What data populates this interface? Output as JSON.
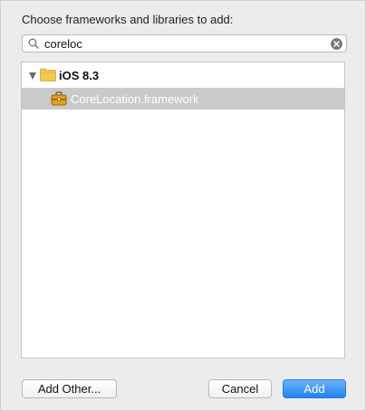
{
  "dialog": {
    "title": "Choose frameworks and libraries to add:"
  },
  "search": {
    "value": "coreloc",
    "icon": "search-icon",
    "clear_icon": "clear-icon"
  },
  "tree": {
    "group": {
      "label": "iOS 8.3",
      "expanded": true,
      "icon": "folder-icon",
      "items": [
        {
          "label": "CoreLocation.framework",
          "icon": "toolbox-icon",
          "selected": true
        }
      ]
    }
  },
  "buttons": {
    "add_other": "Add Other...",
    "cancel": "Cancel",
    "add": "Add"
  },
  "colors": {
    "accent": "#1f82f1",
    "selection": "#cacaca",
    "folder": "#f2c94c"
  }
}
